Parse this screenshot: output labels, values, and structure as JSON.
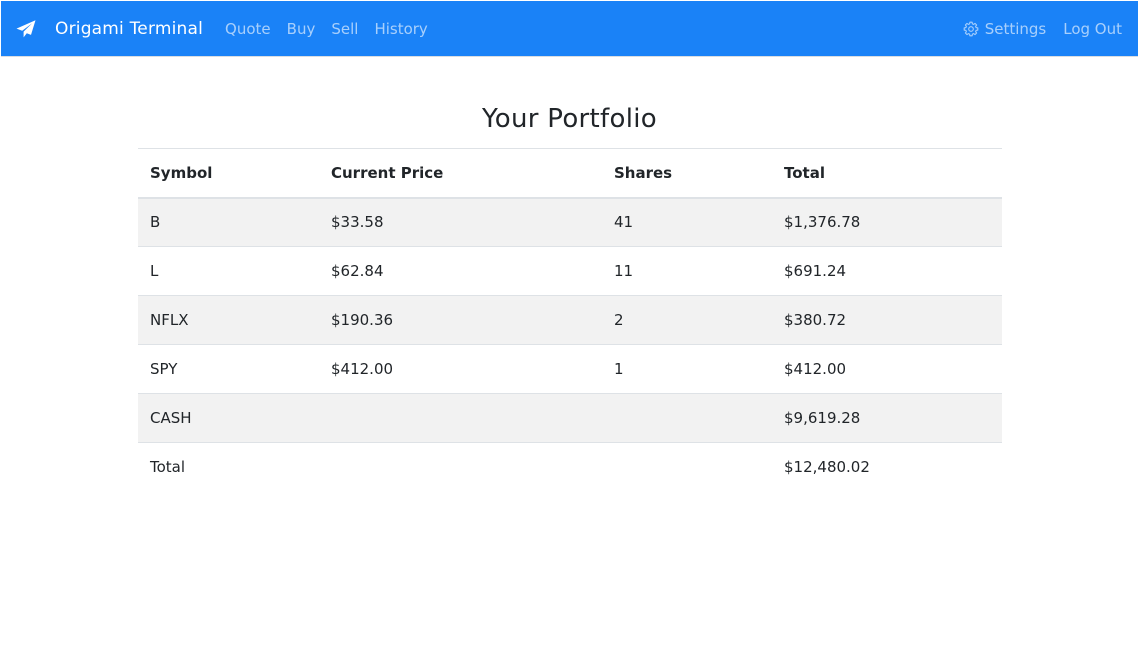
{
  "navbar": {
    "brand": "Origami Terminal",
    "links": [
      "Quote",
      "Buy",
      "Sell",
      "History"
    ],
    "settings": "Settings",
    "logout": "Log Out"
  },
  "page": {
    "title": "Your Portfolio"
  },
  "table": {
    "headers": [
      "Symbol",
      "Current Price",
      "Shares",
      "Total"
    ],
    "rows": [
      {
        "symbol": "B",
        "price": "$33.58",
        "shares": "41",
        "total": "$1,376.78"
      },
      {
        "symbol": "L",
        "price": "$62.84",
        "shares": "11",
        "total": "$691.24"
      },
      {
        "symbol": "NFLX",
        "price": "$190.36",
        "shares": "2",
        "total": "$380.72"
      },
      {
        "symbol": "SPY",
        "price": "$412.00",
        "shares": "1",
        "total": "$412.00"
      },
      {
        "symbol": "CASH",
        "price": "",
        "shares": "",
        "total": "$9,619.28"
      },
      {
        "symbol": "Total",
        "price": "",
        "shares": "",
        "total": "$12,480.02"
      }
    ]
  },
  "colors": {
    "navbar": "#1a82f7",
    "stripe": "#f2f2f2"
  },
  "icons": {
    "brand": "paper-plane-icon",
    "settings": "gear-icon"
  }
}
